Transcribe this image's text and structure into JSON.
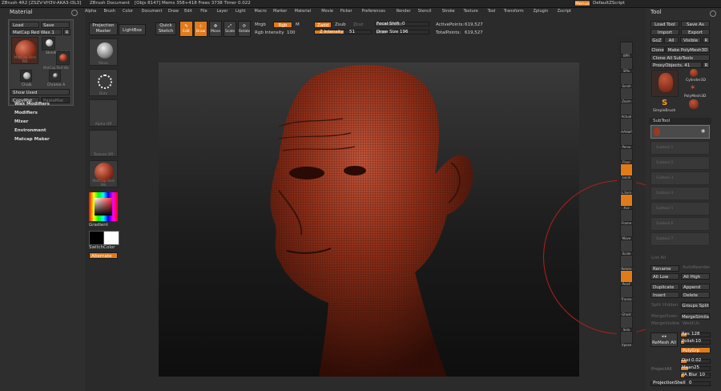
{
  "app": {
    "title": "ZBrush 4R2 [ZSZV-VH3V-AKA3-I3L3]",
    "document": "ZBrush Document",
    "status": "[Objs 8147] Mems 358+418 Frees 3738 Timer 0.022",
    "menu_bar": [
      "Alpha",
      "Brush",
      "Color",
      "Document",
      "Draw",
      "Edit",
      "File",
      "Layer",
      "Light",
      "Macro",
      "Marker",
      "Material",
      "Movie",
      "Picker",
      "Preferences",
      "Render",
      "Stencil",
      "Stroke",
      "Texture",
      "Tool",
      "Transform",
      "Zplugin",
      "Zscript"
    ],
    "menus_button": "Menus",
    "script_button": "DefaultZScript"
  },
  "left_panel": {
    "title": "Material",
    "load": "Load",
    "save": "Save",
    "matcap_row": "MatCap Red Wax.1",
    "r_button": "R",
    "materials": [
      {
        "label": "MatCap Red Wa"
      },
      {
        "label": "SkinShade4"
      },
      {
        "label": "MatCap Red Wa"
      },
      {
        "label": "Chalk"
      },
      {
        "label": "Chrome A"
      }
    ],
    "show_used": "Show Used",
    "copymat": "CopyMat",
    "pastemat": "PasteMat",
    "sections": [
      "Wax Modifiers",
      "Modifiers",
      "Mixer",
      "Environment",
      "Matcap Maker"
    ]
  },
  "tray": {
    "projection_master": "Projection Master",
    "lightbox": "LightBox",
    "quick_sketch": "Quick Sketch",
    "brush_label": "Move",
    "stroke_label": "Dots",
    "alpha_label": "Alpha Off",
    "texture_label": "Texture Off",
    "material_label": "MatCap Red Wa",
    "gradient": "Gradient",
    "switch_color": "SwitchColor",
    "alternate": "Alternate"
  },
  "top_toolbar": {
    "edit": "Edit",
    "draw": "Draw",
    "move": "Move",
    "scale": "Scale",
    "rotate": "Rotate",
    "mrgb": "Mrgb",
    "rgb": "Rgb",
    "m": "M",
    "rgb_intensity_label": "Rgb Intensity",
    "rgb_intensity": "100",
    "zadd": "Zadd",
    "zsub": "Zsub",
    "zcut": "Zcut",
    "z_intensity_label": "Z Intensity",
    "z_intensity": "51",
    "focal_shift_label": "Focal Shift",
    "focal_shift": "0",
    "draw_size_label": "Draw Size",
    "draw_size": "196",
    "active_points_label": "ActivePoints:",
    "active_points": "619,527",
    "total_points_label": "TotalPoints:",
    "total_points": "619,527"
  },
  "right_shelf": [
    "BPR",
    "SPix",
    "Scroll",
    "Zoom",
    "Actual",
    "AAHalf",
    "Persp",
    "Floor",
    "Local",
    "L.Sym",
    "Xyz",
    "Frame",
    "Move",
    "Scale",
    "Rotate",
    "PolyF",
    "Transp",
    "Ghost",
    "Solo",
    "Xpose"
  ],
  "tool_panel": {
    "title": "Tool",
    "load_tool": "Load Tool",
    "save_as": "Save As",
    "import": "Import",
    "export": "Export",
    "goz": "GoZ",
    "all": "All",
    "visible": "Visible",
    "r": "R",
    "clone": "Clone",
    "make_polymesh": "Make PolyMesh3D",
    "clone_all_subtools": "Clone All SubTools",
    "proxy_objects": "ProxyObjects. 41",
    "tools": [
      {
        "label": ""
      },
      {
        "label": "Cylinder3D"
      },
      {
        "label": "PolyMesh3D"
      },
      {
        "label": "SimpleBrush"
      },
      {
        "label": ""
      }
    ],
    "subtool_header": "SubTool",
    "subtool_slots": [
      "Subtool 1",
      "Subtool 2",
      "Subtool 3",
      "Subtool 4",
      "Subtool 5",
      "Subtool 6",
      "Subtool 7"
    ],
    "list_all": "List All",
    "autoreorder": "AutoReorder",
    "rename": "Rename",
    "all_low": "All Low",
    "all_high": "All High",
    "duplicate": "Duplicate",
    "append": "Append",
    "insert": "Insert",
    "delete": "Delete",
    "split_hidden": "Split Hidden",
    "groups_split": "Groups Split",
    "merge_down": "MergeDown",
    "merge_similar": "MergeSimilar",
    "merge_visible": "MergeVisible",
    "weld": "Weld",
    "uv": "Uv",
    "remesh_all": "ReMesh All",
    "res_label": "Res",
    "res": "128",
    "polish_label": "Polish",
    "polish": "10",
    "polygrp": "PolyGrp",
    "project_all": "ProjectAll",
    "dist_label": "Dist",
    "dist": "0.02",
    "mean_label": "Mean",
    "mean": "25",
    "pa_blur_label": "PA Blur",
    "pa_blur": "10",
    "projection_shell_label": "ProjectionShell",
    "projection_shell": "0"
  },
  "colors": {
    "accent": "#e07b1a",
    "skin": "#8a2d18",
    "background": "#2b2b2b"
  }
}
